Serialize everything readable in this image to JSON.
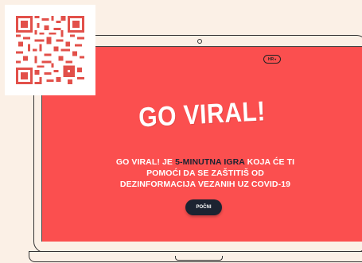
{
  "language_selector": {
    "label": "HR",
    "chevron_icon": "chevron-down-icon"
  },
  "hero": {
    "title": "GO VIRAL!",
    "description_parts": {
      "lead": "GO VIRAL! JE ",
      "highlight": "5-MINUTNA IGRA",
      "rest": " KOJA ĆE TI POMOĆI DA SE ZAŠTITIŠ OD DEZINFORMACIJA VEZANIH UZ COVID-19"
    },
    "start_label": "POČNI"
  },
  "qr_code": {
    "icon": "qr-code-icon",
    "color": "#e2504a"
  },
  "colors": {
    "background": "#fbf0e6",
    "screen": "#fb4f4f",
    "button": "#1c2331",
    "highlight_text": "#1c2331",
    "text": "#ffffff"
  }
}
